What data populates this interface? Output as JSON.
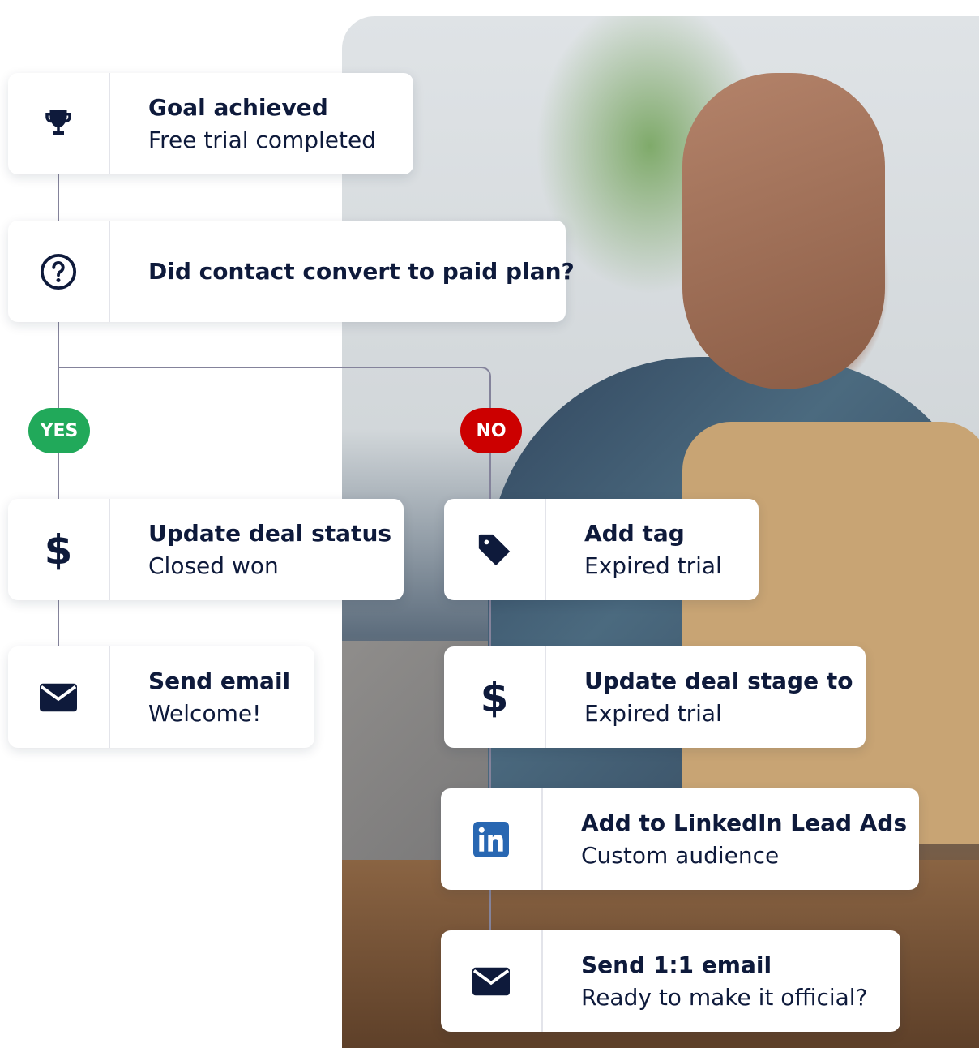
{
  "branches": {
    "yes_label": "YES",
    "no_label": "NO",
    "yes_color": "#21a95a",
    "no_color": "#cc0000"
  },
  "colors": {
    "text": "#0e1a3b",
    "connector": "#84839b",
    "linkedin": "#2867b2"
  },
  "cards": [
    {
      "id": "goal",
      "icon": "trophy-icon",
      "title": "Goal achieved",
      "subtitle": "Free trial completed"
    },
    {
      "id": "condition",
      "icon": "question-circle-icon",
      "title": "Did contact convert to paid plan?",
      "subtitle": ""
    },
    {
      "id": "update-deal-status",
      "icon": "dollar-icon",
      "title": "Update deal status",
      "subtitle": "Closed won"
    },
    {
      "id": "add-tag",
      "icon": "tag-icon",
      "title": "Add tag",
      "subtitle": "Expired trial"
    },
    {
      "id": "send-email",
      "icon": "envelope-icon",
      "title": "Send email",
      "subtitle": "Welcome!"
    },
    {
      "id": "update-deal-stage",
      "icon": "dollar-icon",
      "title": "Update deal stage to",
      "subtitle": "Expired trial"
    },
    {
      "id": "linkedin",
      "icon": "linkedin-icon",
      "title": "Add to LinkedIn Lead Ads",
      "subtitle": "Custom audience"
    },
    {
      "id": "send-1to1-email",
      "icon": "envelope-icon",
      "title": "Send 1:1 email",
      "subtitle": "Ready to make it official?"
    }
  ]
}
